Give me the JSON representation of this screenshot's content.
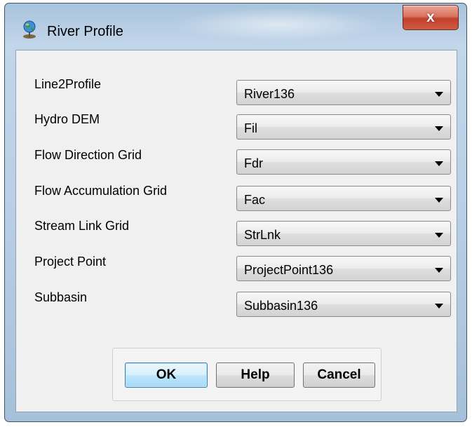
{
  "window": {
    "title": "River Profile",
    "close_symbol": "x"
  },
  "fields": [
    {
      "label": "Line2Profile",
      "value": "River136"
    },
    {
      "label": "Hydro DEM",
      "value": "Fil"
    },
    {
      "label": "Flow Direction Grid",
      "value": "Fdr"
    },
    {
      "label": "Flow Accumulation Grid",
      "value": "Fac"
    },
    {
      "label": "Stream Link Grid",
      "value": "StrLnk"
    },
    {
      "label": "Project Point",
      "value": "ProjectPoint136"
    },
    {
      "label": "Subbasin",
      "value": "Subbasin136"
    }
  ],
  "buttons": {
    "ok": "OK",
    "help": "Help",
    "cancel": "Cancel"
  },
  "icons": {
    "app": "globe-pin-icon",
    "dropdown": "chevron-down-icon"
  },
  "colors": {
    "titlebar": "#b8cfe5",
    "close": "#c2402b",
    "client": "#f0f0f0",
    "default_button": "#bee6fd"
  }
}
